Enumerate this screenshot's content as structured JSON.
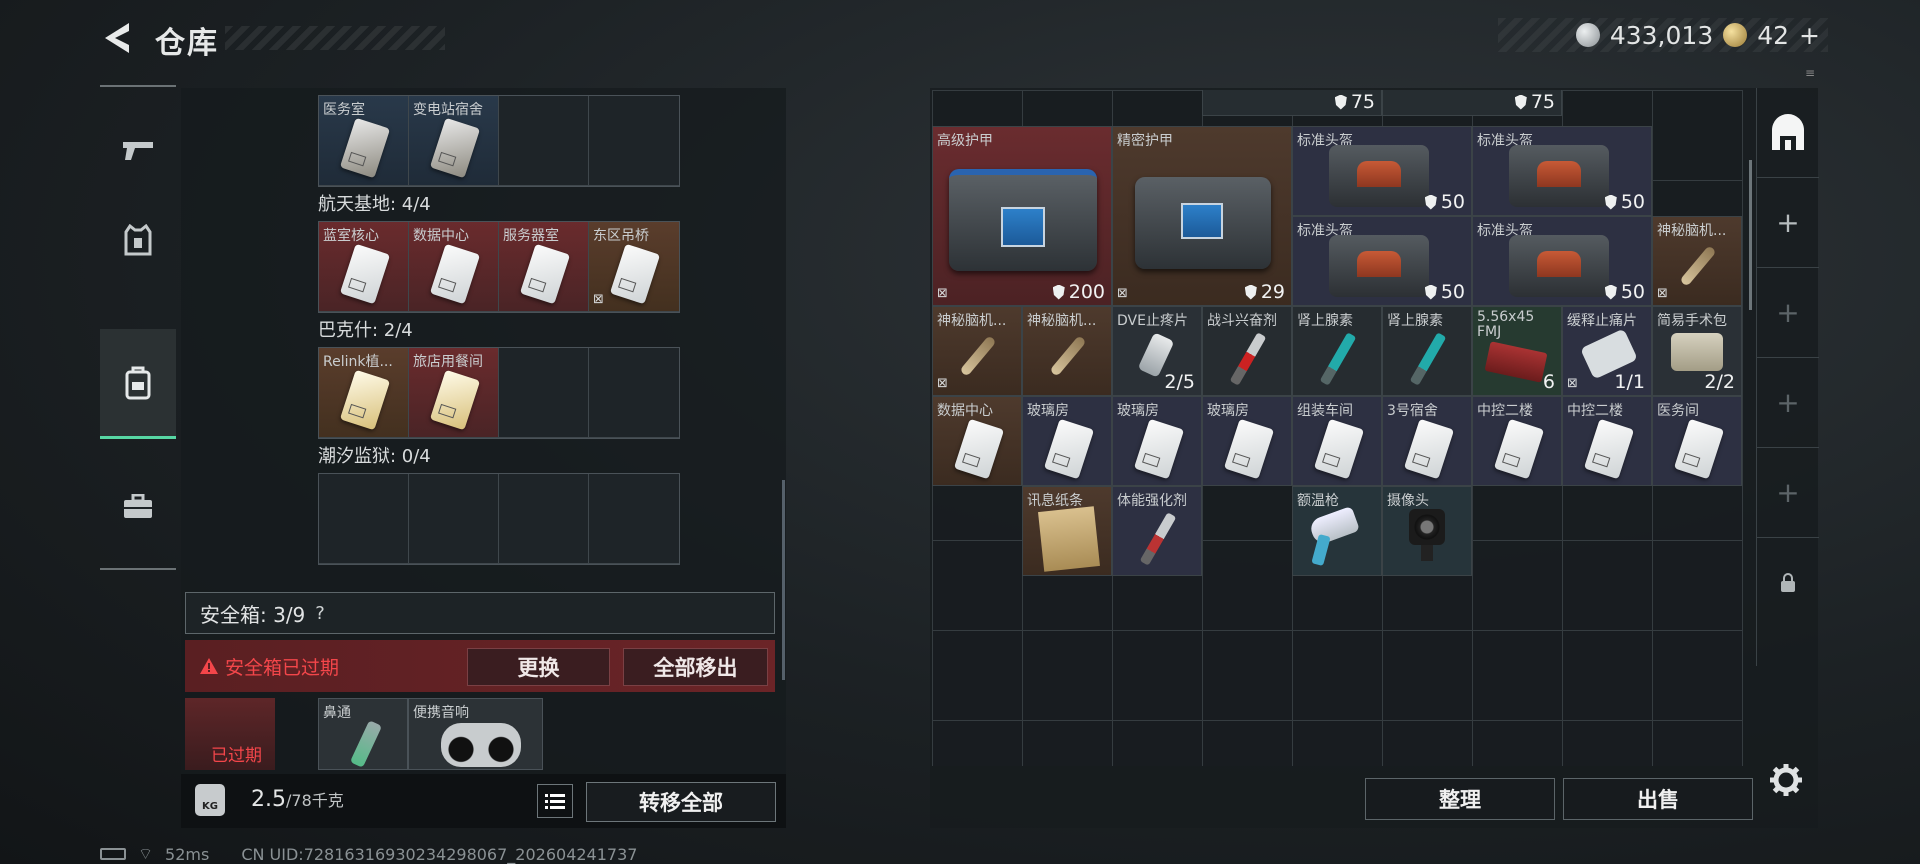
{
  "header": {
    "title": "仓库",
    "silver_coins": "433,013",
    "gold_coins": "42",
    "gold_plus": "+",
    "menu_dots": "≡"
  },
  "nav": [
    {
      "name": "weapons",
      "icon": "gun-icon"
    },
    {
      "name": "armor",
      "icon": "vest-icon"
    },
    {
      "name": "backpack",
      "icon": "backpack-icon"
    },
    {
      "name": "briefcase",
      "icon": "briefcase-icon"
    }
  ],
  "left": {
    "top_row": [
      {
        "name": "医务室",
        "color": "blue"
      },
      {
        "name": "变电站宿舍",
        "color": "blue"
      },
      {
        "name": "",
        "color": "empty"
      },
      {
        "name": "",
        "color": "empty"
      }
    ],
    "region1": "航天基地: 4/4",
    "region1_row": [
      {
        "name": "蓝室核心",
        "color": "red"
      },
      {
        "name": "数据中心",
        "color": "red"
      },
      {
        "name": "服务器室",
        "color": "red"
      },
      {
        "name": "东区吊桥",
        "color": "brown",
        "nodrop": true
      }
    ],
    "region2": "巴克什: 2/4",
    "region2_row": [
      {
        "name": "Relink植...",
        "color": "brown",
        "card": "gold"
      },
      {
        "name": "旅店用餐间",
        "color": "red",
        "card": "gold"
      },
      {
        "name": "",
        "color": "empty"
      },
      {
        "name": "",
        "color": "empty"
      }
    ],
    "region3": "潮汐监狱: 0/4",
    "safebox_label": "安全箱: 3/9",
    "safebox_help": "?",
    "expired_warning": "安全箱已过期",
    "swap_button": "更换",
    "remove_all_button": "全部移出",
    "safe_expired_tag": "已过期",
    "safe_items": [
      "鼻通",
      "便携音响"
    ],
    "weight_value": "2.5",
    "weight_max": "/78千克",
    "kg_label": "KG",
    "transfer_all": "转移全部"
  },
  "status": {
    "ping": "52ms",
    "uid": "CN UID:72816316930234298067_202604241737"
  },
  "right": {
    "partial_values": [
      "75",
      "75"
    ],
    "items": {
      "armor1": {
        "name": "高级护甲",
        "durability": "200"
      },
      "armor2": {
        "name": "精密护甲",
        "durability": "29"
      },
      "helm1": {
        "name": "标准头盔",
        "durability": "50"
      },
      "helm2": {
        "name": "标准头盔",
        "durability": "50"
      },
      "helm3": {
        "name": "标准头盔",
        "durability": "50"
      },
      "helm4": {
        "name": "标准头盔",
        "durability": "50"
      },
      "implant1": {
        "name": "神秘脑机..."
      },
      "implant2": {
        "name": "神秘脑机..."
      },
      "implant3": {
        "name": "神秘脑机..."
      },
      "dve": {
        "name": "DVE止疼片",
        "count": "2/5"
      },
      "stim": {
        "name": "战斗兴奋剂"
      },
      "adren1": {
        "name": "肾上腺素"
      },
      "adren2": {
        "name": "肾上腺素"
      },
      "ammo": {
        "name": "5.56x45 FMJ",
        "count": "6"
      },
      "pain": {
        "name": "缓释止痛片",
        "count": "1/1"
      },
      "kit": {
        "name": "简易手术包",
        "count": "2/2"
      },
      "card_row": [
        "数据中心",
        "玻璃房",
        "玻璃房",
        "玻璃房",
        "组装车间",
        "3号宿舍",
        "中控二楼",
        "中控二楼",
        "医务间"
      ],
      "note": {
        "name": "讯息纸条"
      },
      "enhance": {
        "name": "体能强化剂"
      },
      "thermo": {
        "name": "额温枪"
      },
      "camera": {
        "name": "摄像头"
      }
    },
    "sort_button": "整理",
    "sell_button": "出售"
  }
}
